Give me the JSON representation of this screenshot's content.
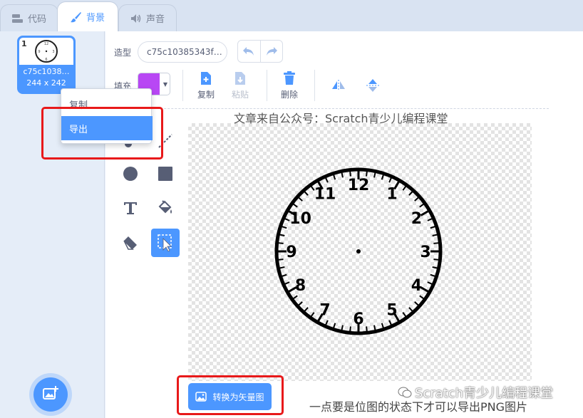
{
  "tabs": [
    {
      "label": "代码",
      "icon": "code-blocks-icon"
    },
    {
      "label": "背景",
      "icon": "brush-icon"
    },
    {
      "label": "声音",
      "icon": "speaker-icon"
    }
  ],
  "costume_list": {
    "items": [
      {
        "number": "1",
        "name": "c75c1038…",
        "size": "244 x 242"
      }
    ],
    "add_icon": "add-backdrop-icon"
  },
  "context_menu": {
    "items": [
      {
        "label": "复制"
      },
      {
        "label": "导出"
      }
    ]
  },
  "editor": {
    "costume_label": "造型",
    "costume_name": "c75c10385343f…",
    "fill_label": "填充",
    "fill_color": "#b847f4",
    "actions": [
      {
        "label": "复制",
        "icon": "copy-icon",
        "enabled": true
      },
      {
        "label": "粘贴",
        "icon": "paste-icon",
        "enabled": false
      },
      {
        "label": "删除",
        "icon": "trash-icon",
        "enabled": true
      }
    ],
    "convert_button": "转换为矢量图"
  },
  "clock": {
    "numbers": [
      "12",
      "1",
      "2",
      "3",
      "4",
      "5",
      "6",
      "7",
      "8",
      "9",
      "10",
      "11"
    ]
  },
  "overlay": {
    "watermark": "文章来自公众号：Scratch青少儿编程课堂",
    "caption": "一点要是位图的状态下才可以导出PNG图片",
    "brand": "Scratch青少儿编程课堂"
  },
  "colors": {
    "accent": "#4c97ff",
    "highlight": "#e8191a"
  }
}
